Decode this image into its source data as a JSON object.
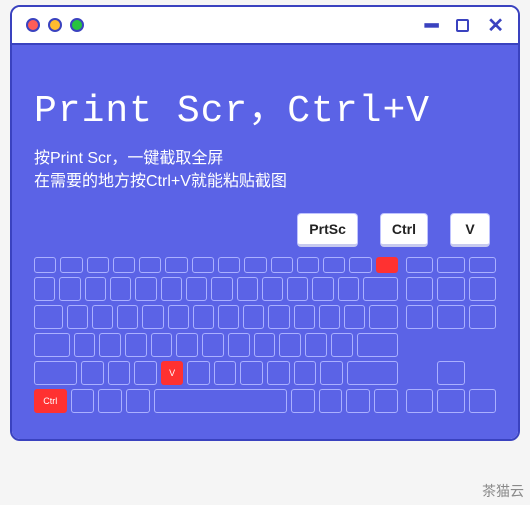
{
  "headline": "Print Scr，Ctrl+V",
  "subline1": "按Print Scr，一键截取全屏",
  "subline2": "在需要的地方按Ctrl+V就能粘贴截图",
  "callouts": {
    "prtsc": "PrtSc",
    "ctrl": "Ctrl",
    "v": "V"
  },
  "highlight_keys": {
    "prtsc": "PrtSc",
    "v": "V",
    "ctrl": "Ctrl"
  },
  "watermark": "茶猫云"
}
